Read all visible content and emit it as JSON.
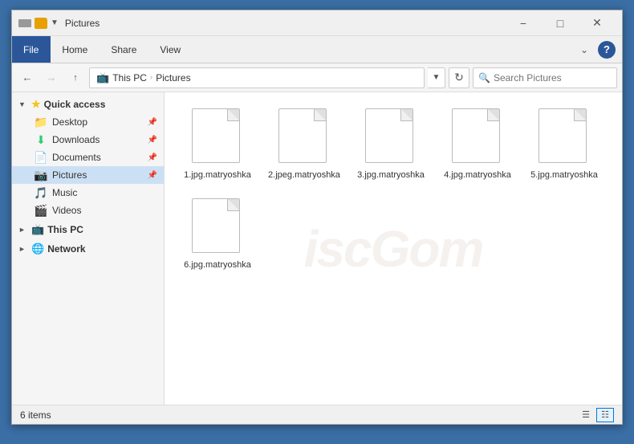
{
  "window": {
    "title": "Pictures",
    "titlebar_icons": [
      "minimize",
      "maximize",
      "close"
    ]
  },
  "ribbon": {
    "tabs": [
      "File",
      "Home",
      "Share",
      "View"
    ],
    "active_tab": "File"
  },
  "addressbar": {
    "back_disabled": false,
    "forward_disabled": true,
    "path_parts": [
      "This PC",
      "Pictures"
    ],
    "search_placeholder": "Search Pictures"
  },
  "sidebar": {
    "sections": [
      {
        "id": "quick-access",
        "label": "Quick access",
        "expanded": true,
        "items": [
          {
            "id": "desktop",
            "label": "Desktop",
            "icon": "folder",
            "pinned": true
          },
          {
            "id": "downloads",
            "label": "Downloads",
            "icon": "downloads",
            "pinned": true
          },
          {
            "id": "documents",
            "label": "Documents",
            "icon": "folder",
            "pinned": true
          },
          {
            "id": "pictures",
            "label": "Pictures",
            "icon": "pictures",
            "pinned": true,
            "active": true
          },
          {
            "id": "music",
            "label": "Music",
            "icon": "music",
            "pinned": false
          },
          {
            "id": "videos",
            "label": "Videos",
            "icon": "folder",
            "pinned": false
          }
        ]
      },
      {
        "id": "this-pc",
        "label": "This PC",
        "expanded": false,
        "items": []
      },
      {
        "id": "network",
        "label": "Network",
        "expanded": false,
        "items": []
      }
    ]
  },
  "files": [
    {
      "id": "f1",
      "name": "1.jpg.matryoshka"
    },
    {
      "id": "f2",
      "name": "2.jpeg.matryoshka"
    },
    {
      "id": "f3",
      "name": "3.jpg.matryoshka"
    },
    {
      "id": "f4",
      "name": "4.jpg.matryoshka"
    },
    {
      "id": "f5",
      "name": "5.jpg.matryoshka"
    },
    {
      "id": "f6",
      "name": "6.jpg.matryoshka"
    }
  ],
  "statusbar": {
    "count_text": "6 items",
    "view_icons": [
      "list",
      "tiles"
    ]
  },
  "watermark": "iscGom"
}
